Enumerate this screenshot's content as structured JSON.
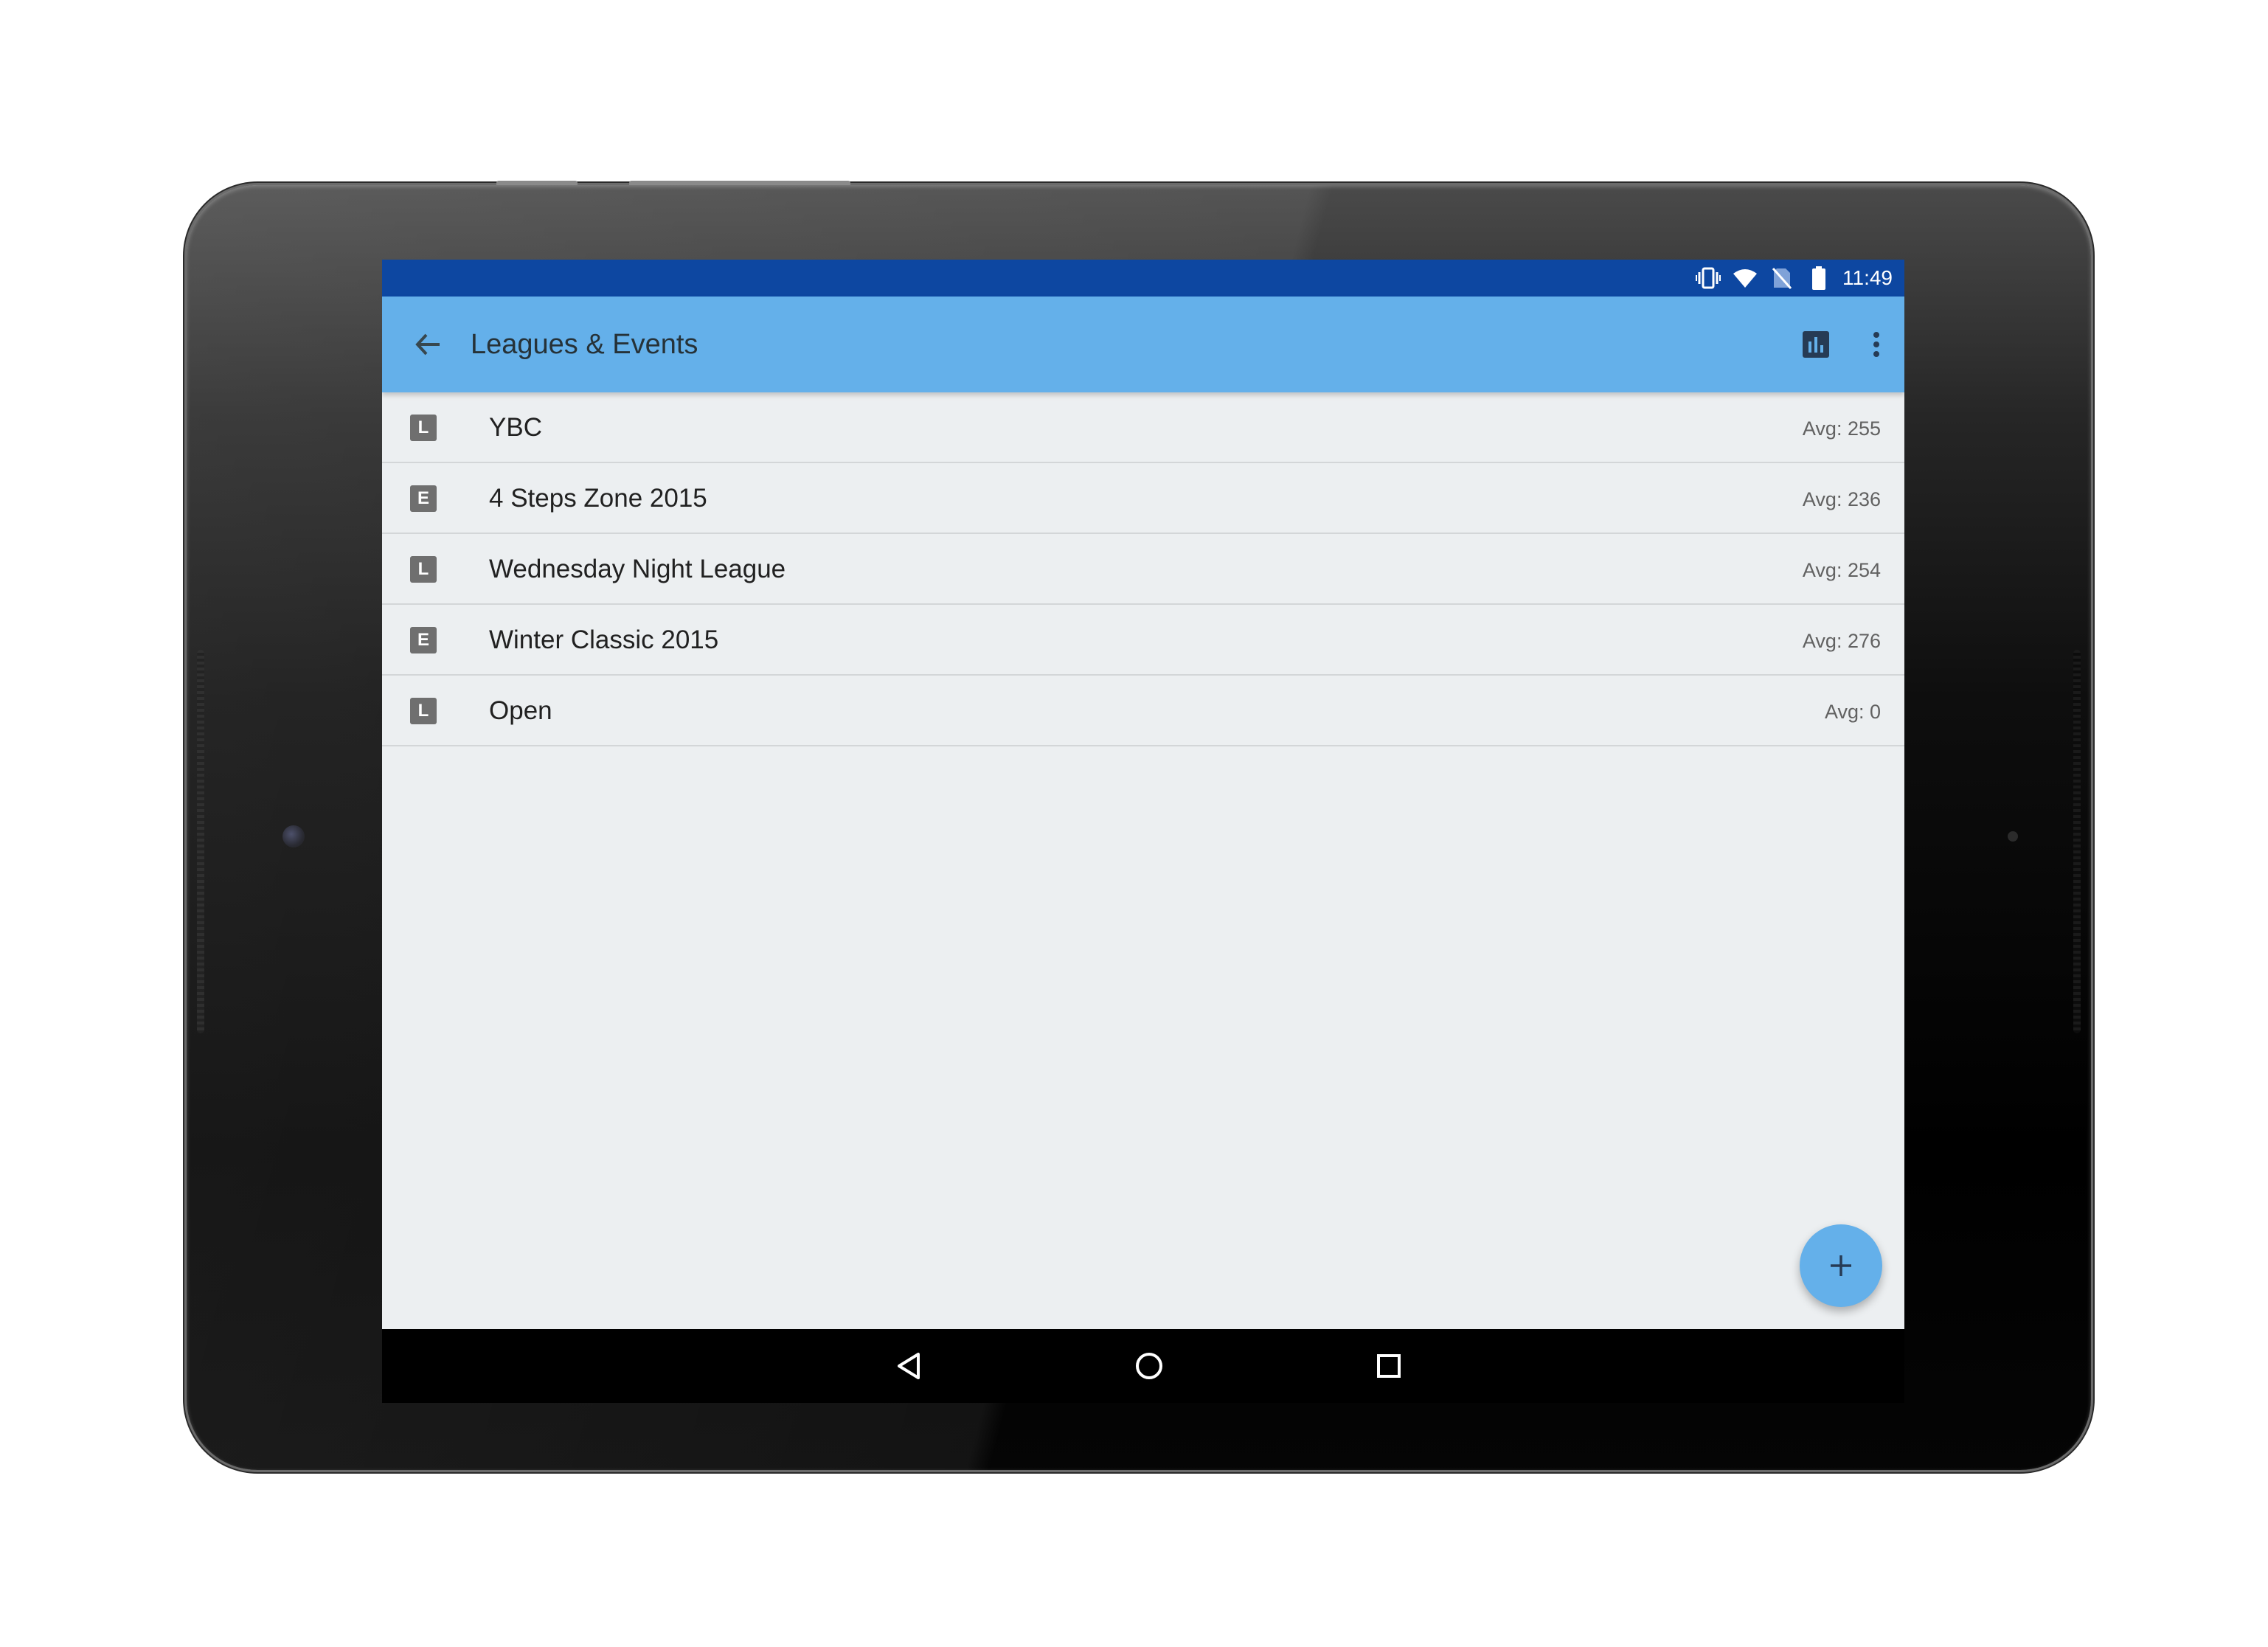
{
  "status_bar": {
    "time": "11:49",
    "icons": [
      "vibrate-icon",
      "wifi-icon",
      "no-sim-icon",
      "battery-icon"
    ]
  },
  "app_bar": {
    "title": "Leagues & Events",
    "back_icon": "arrow-back-icon",
    "actions": [
      "bar-chart-icon",
      "more-vert-icon"
    ]
  },
  "list": {
    "items": [
      {
        "type": "L",
        "name": "YBC",
        "avg": "Avg: 255"
      },
      {
        "type": "E",
        "name": "4 Steps Zone 2015",
        "avg": "Avg: 236"
      },
      {
        "type": "L",
        "name": "Wednesday Night League",
        "avg": "Avg: 254"
      },
      {
        "type": "E",
        "name": "Winter Classic 2015",
        "avg": "Avg: 276"
      },
      {
        "type": "L",
        "name": "Open",
        "avg": "Avg: 0"
      }
    ]
  },
  "fab": {
    "icon": "plus-icon"
  },
  "nav_bar": {
    "buttons": [
      "back-triangle-icon",
      "home-circle-icon",
      "recents-square-icon"
    ]
  },
  "colors": {
    "status_bar": "#0d47a1",
    "app_bar": "#64b0ea",
    "background": "#eceff1",
    "badge": "#6f6f6f"
  }
}
